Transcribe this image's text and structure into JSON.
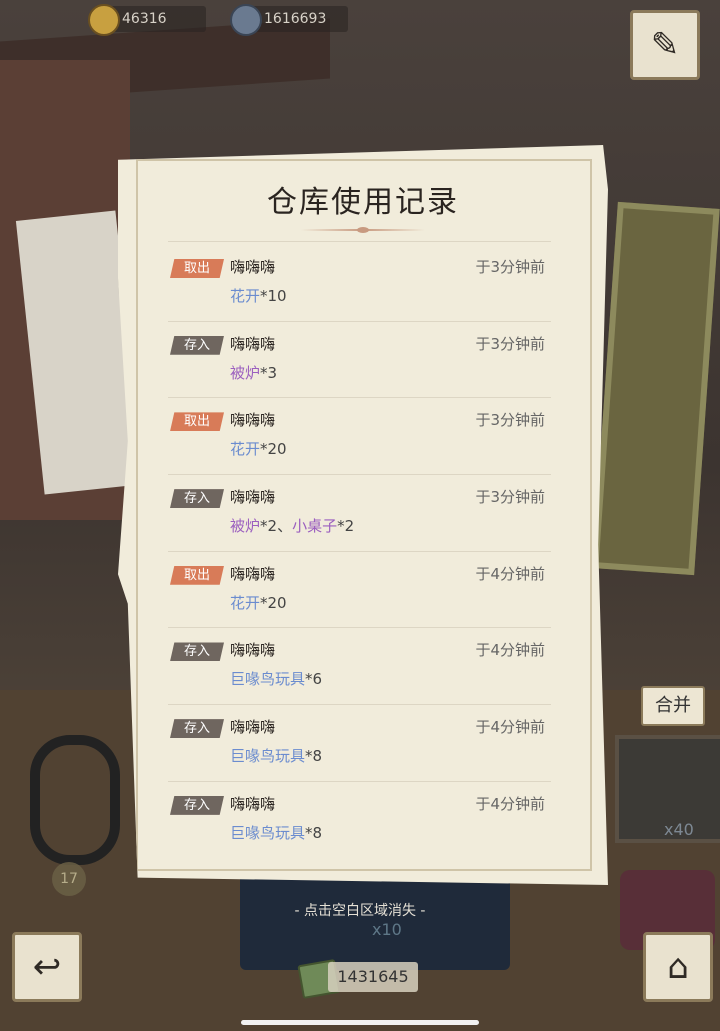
{
  "resources": {
    "gold": "46316",
    "gems": "1616693",
    "money": "1431645"
  },
  "dialog": {
    "title": "仓库使用记录",
    "records": [
      {
        "tag": "取出",
        "kind": "out",
        "name": "嗨嗨嗨",
        "time": "于3分钟前",
        "items": [
          {
            "item": "花开",
            "qty": "*10",
            "color": "blue"
          }
        ]
      },
      {
        "tag": "存入",
        "kind": "in",
        "name": "嗨嗨嗨",
        "time": "于3分钟前",
        "items": [
          {
            "item": "被炉",
            "qty": "*3",
            "color": "purple"
          }
        ]
      },
      {
        "tag": "取出",
        "kind": "out",
        "name": "嗨嗨嗨",
        "time": "于3分钟前",
        "items": [
          {
            "item": "花开",
            "qty": "*20",
            "color": "blue"
          }
        ]
      },
      {
        "tag": "存入",
        "kind": "in",
        "name": "嗨嗨嗨",
        "time": "于3分钟前",
        "items": [
          {
            "item": "被炉",
            "qty": "*2",
            "color": "purple"
          },
          {
            "item": "小桌子",
            "qty": "*2",
            "color": "purple"
          }
        ]
      },
      {
        "tag": "取出",
        "kind": "out",
        "name": "嗨嗨嗨",
        "time": "于4分钟前",
        "items": [
          {
            "item": "花开",
            "qty": "*20",
            "color": "blue"
          }
        ]
      },
      {
        "tag": "存入",
        "kind": "in",
        "name": "嗨嗨嗨",
        "time": "于4分钟前",
        "items": [
          {
            "item": "巨喙鸟玩具",
            "qty": "*6",
            "color": "blue"
          }
        ]
      },
      {
        "tag": "存入",
        "kind": "in",
        "name": "嗨嗨嗨",
        "time": "于4分钟前",
        "items": [
          {
            "item": "巨喙鸟玩具",
            "qty": "*8",
            "color": "blue"
          }
        ]
      },
      {
        "tag": "存入",
        "kind": "in",
        "name": "嗨嗨嗨",
        "time": "于4分钟前",
        "items": [
          {
            "item": "巨喙鸟玩具",
            "qty": "*8",
            "color": "blue"
          }
        ]
      }
    ],
    "item_separator": "、"
  },
  "dismiss_hint": "- 点击空白区域消失 -",
  "merge_label": "合并",
  "background_labels": {
    "stack_a": "x40",
    "stack_b": "x10",
    "count": "17"
  },
  "icons": {
    "journal": "quill-book-icon",
    "back": "back-arrow-icon",
    "home": "house-icon"
  }
}
